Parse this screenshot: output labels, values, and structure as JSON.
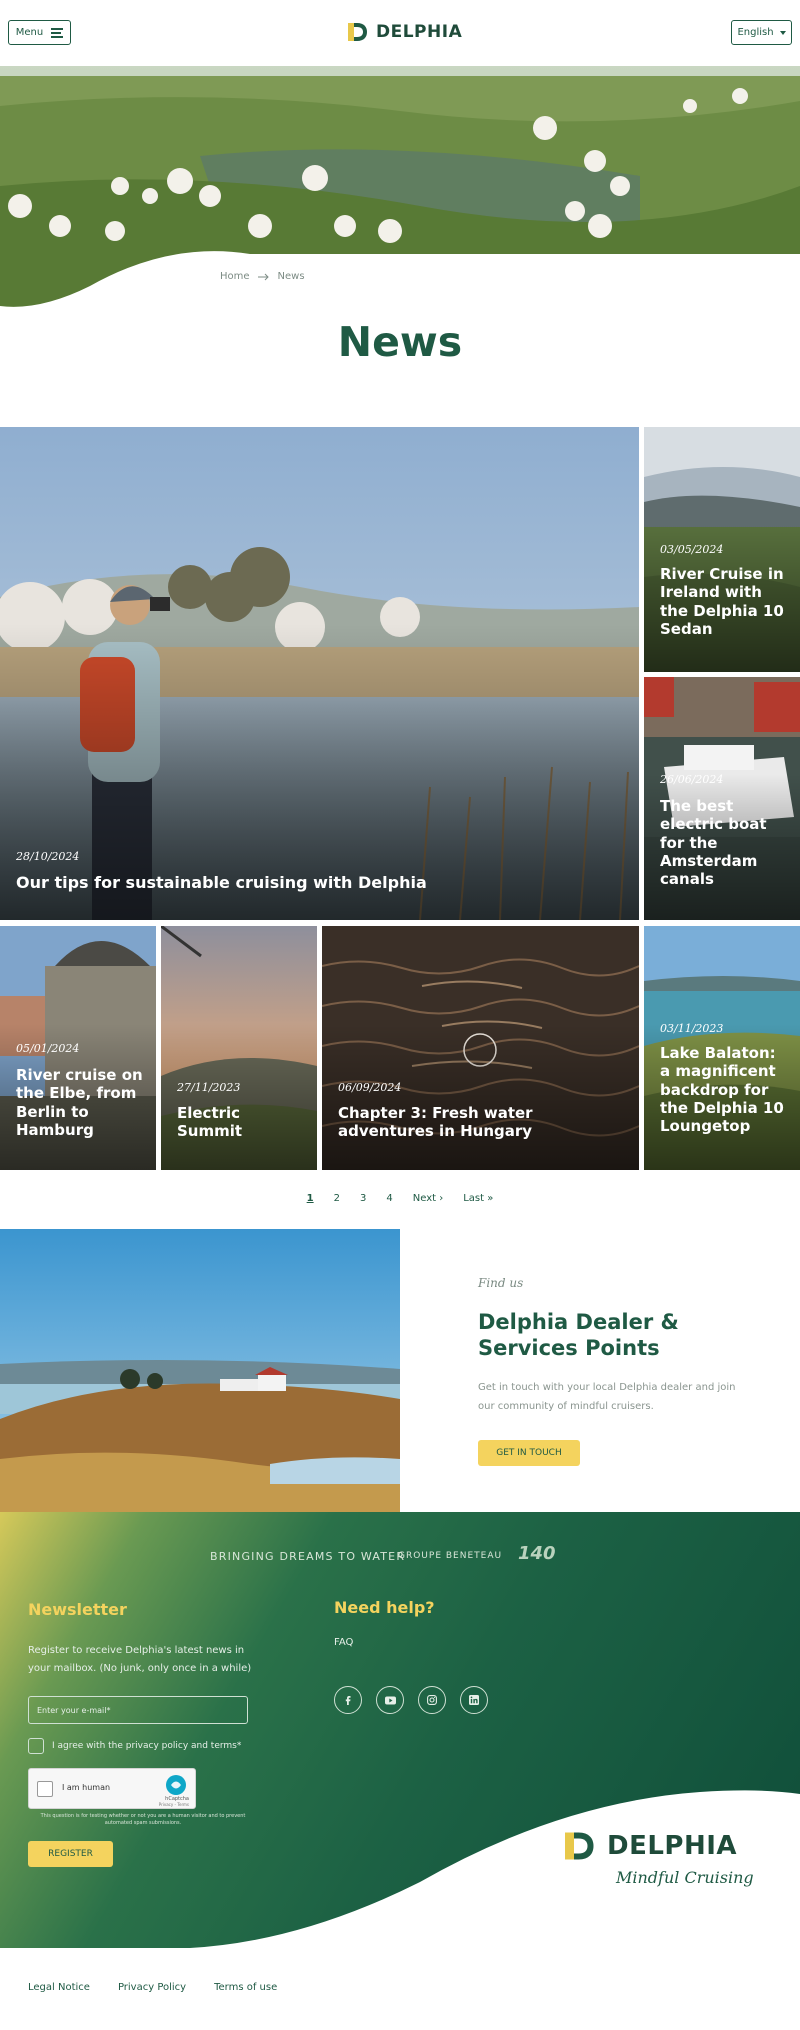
{
  "header": {
    "menu_label": "Menu",
    "brand": "DELPHIA",
    "language": "English"
  },
  "breadcrumb": {
    "home": "Home",
    "current": "News"
  },
  "page_title": "News",
  "news": [
    {
      "date": "28/10/2024",
      "title": "Our tips for sustainable cruising with Delphia"
    },
    {
      "date": "03/05/2024",
      "title": "River Cruise in Ireland with the Delphia 10 Sedan"
    },
    {
      "date": "26/06/2024",
      "title": "The best electric boat for the Amsterdam canals"
    },
    {
      "date": "05/01/2024",
      "title": "River cruise on the Elbe, from Berlin to Hamburg"
    },
    {
      "date": "27/11/2023",
      "title": "Electric Summit"
    },
    {
      "date": "06/09/2024",
      "title": "Chapter 3: Fresh water adventures in Hungary"
    },
    {
      "date": "03/11/2023",
      "title": "Lake Balaton: a magnificent backdrop for the Delphia 10 Loungetop"
    }
  ],
  "pagination": {
    "pages": [
      "1",
      "2",
      "3",
      "4"
    ],
    "next": "Next ›",
    "last": "Last »"
  },
  "find_us": {
    "kicker": "Find us",
    "title": "Delphia Dealer & Services Points",
    "text": "Get in touch with your local Delphia dealer and join our community of mindful cruisers.",
    "button": "GET IN TOUCH"
  },
  "footer": {
    "tagline": "BRINGING DREAMS TO WATER",
    "group": "GROUPE BENETEAU",
    "group_brand": "140",
    "newsletter": {
      "title": "Newsletter",
      "text": "Register to receive Delphia's latest news in your mailbox. (No junk, only once in a while)",
      "email_placeholder": "Enter your e-mail*",
      "agree": "I agree with the privacy policy and terms*",
      "captcha_label": "I am human",
      "captcha_brand": "hCaptcha",
      "captcha_links": "Privacy - Terms",
      "captcha_note": "This question is for testing whether or not you are a human visitor and to prevent automated spam submissions.",
      "register": "REGISTER"
    },
    "help": {
      "title": "Need help?",
      "faq": "FAQ"
    },
    "socials": [
      "facebook-icon",
      "youtube-icon",
      "instagram-icon",
      "linkedin-icon"
    ],
    "brand": "DELPHIA",
    "brand_sub": "Mindful Cruising"
  },
  "legal": {
    "notice": "Legal Notice",
    "privacy": "Privacy Policy",
    "terms": "Terms of use"
  },
  "colors": {
    "primary": "#1f5a44",
    "accent_yellow": "#f4d35e"
  }
}
